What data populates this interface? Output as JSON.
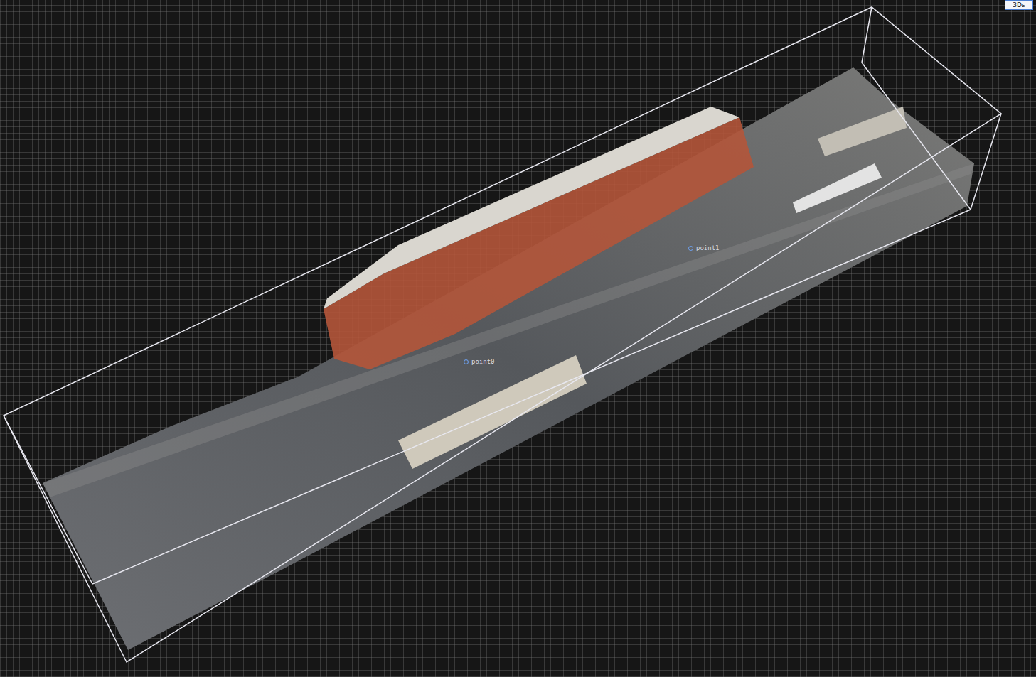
{
  "toolbar": {
    "view_mode": "3Ds"
  },
  "annotations": [
    {
      "label": "point0"
    },
    {
      "label": "point1"
    }
  ]
}
